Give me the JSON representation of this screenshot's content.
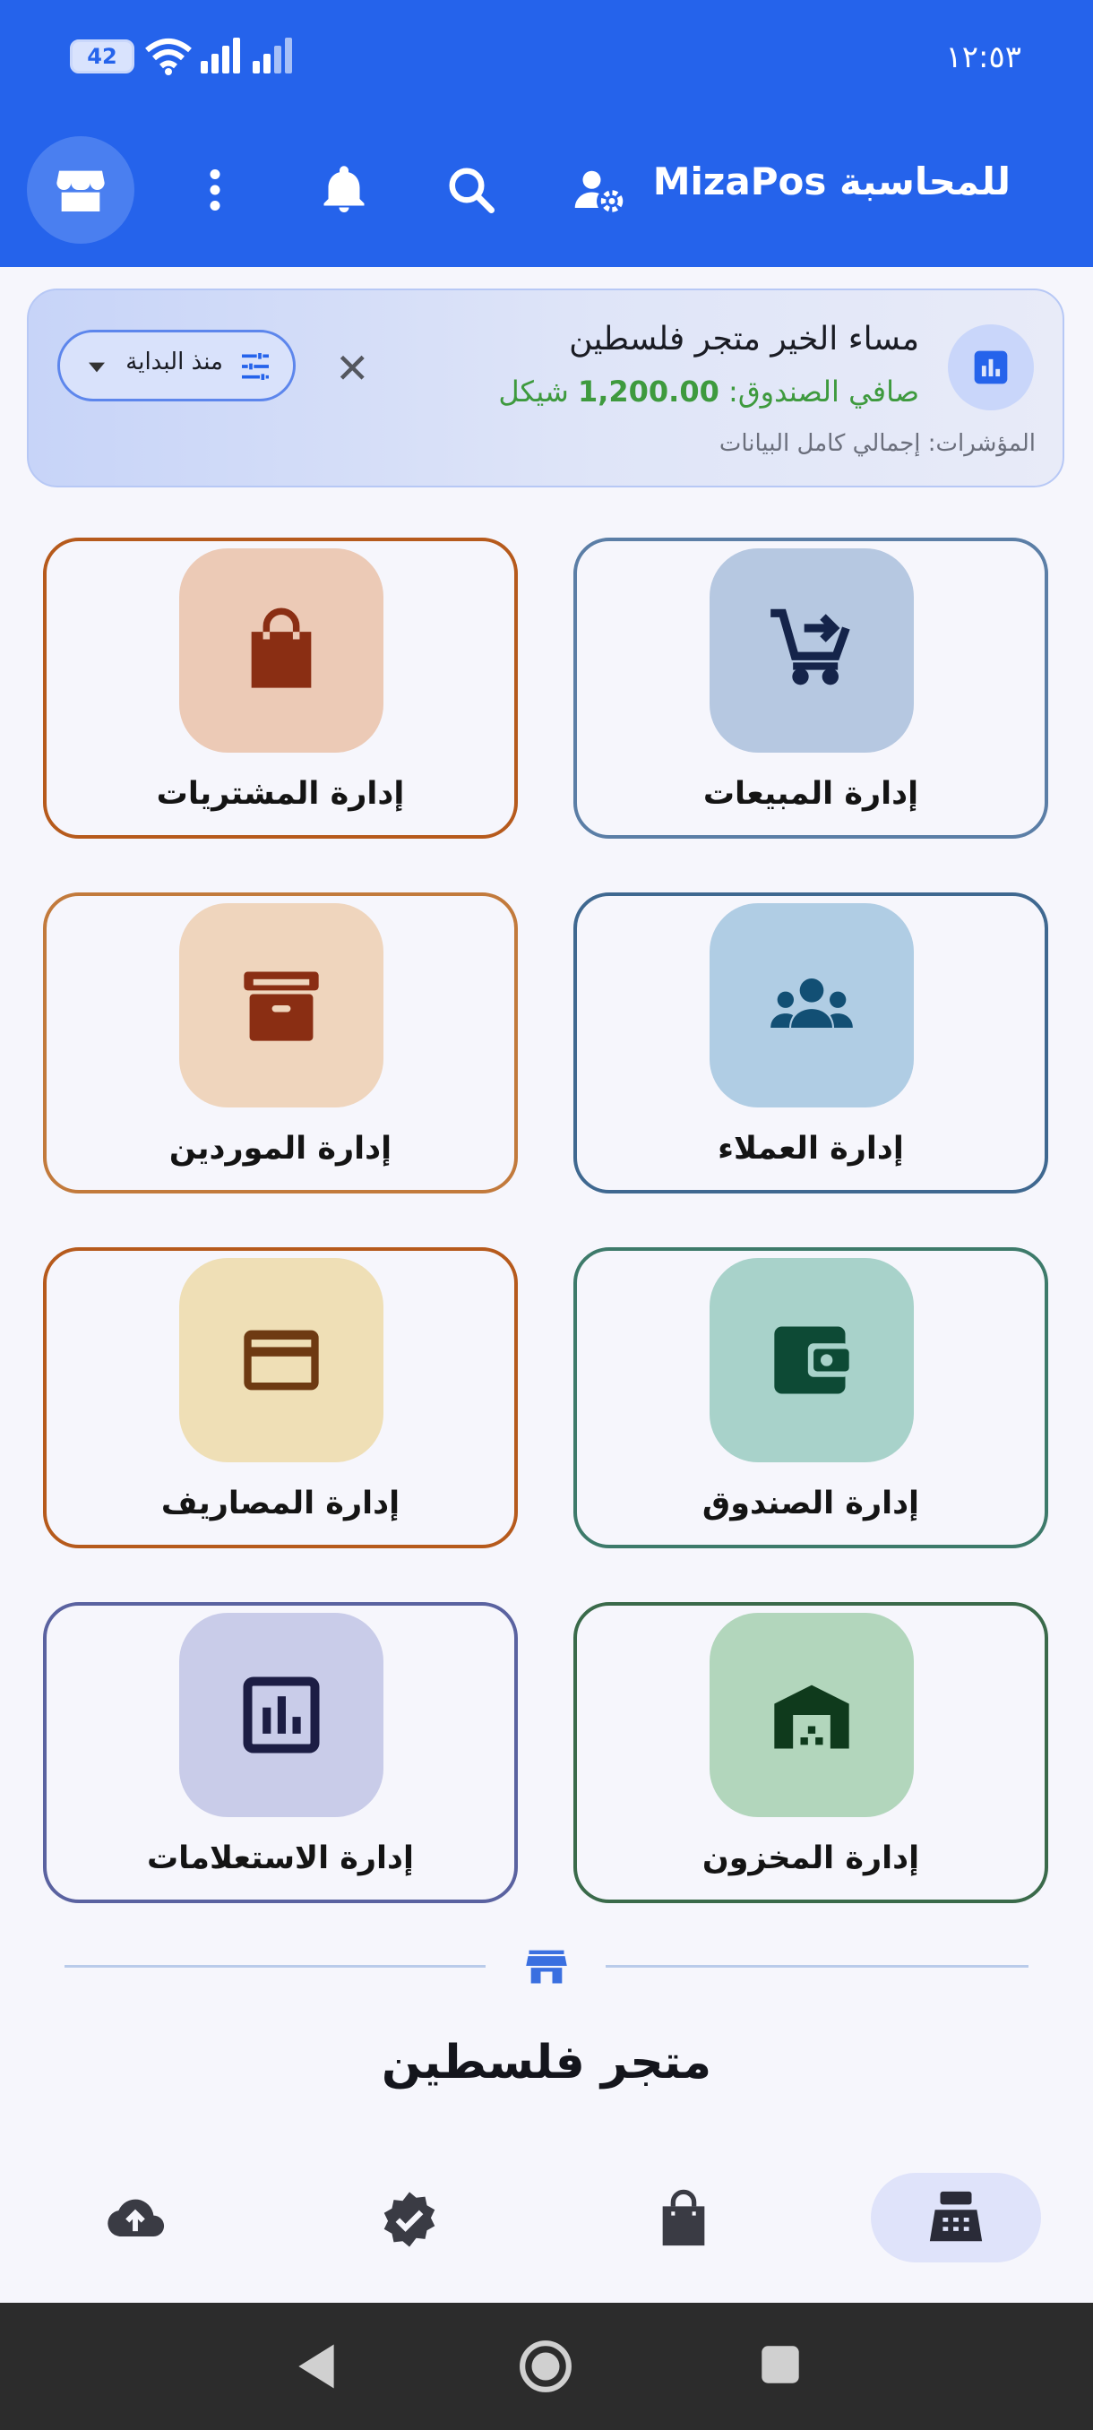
{
  "status_bar": {
    "time": "١٢:٥٣",
    "battery": "42"
  },
  "app_bar": {
    "title": "MizaPos للمحاسبة"
  },
  "banner": {
    "greeting": "مساء الخير متجر فلسطين",
    "cashbox_label": "صافي الصندوق:",
    "cashbox_value": "1,200.00",
    "currency": "شيكل",
    "indicators": "المؤشرات: إجمالي كامل البيانات",
    "filter_label": "منذ البداية"
  },
  "modules": [
    {
      "label": "إدارة المبيعات",
      "icon": "cart-icon"
    },
    {
      "label": "إدارة المشتريات",
      "icon": "shopping-bag-icon"
    },
    {
      "label": "إدارة العملاء",
      "icon": "group-icon"
    },
    {
      "label": "إدارة الموردين",
      "icon": "archive-box-icon"
    },
    {
      "label": "إدارة الصندوق",
      "icon": "wallet-icon"
    },
    {
      "label": "إدارة المصاريف",
      "icon": "credit-card-icon"
    },
    {
      "label": "إدارة المخزون",
      "icon": "warehouse-icon"
    },
    {
      "label": "إدارة الاستعلامات",
      "icon": "bar-chart-icon"
    }
  ],
  "store_name": "متجر فلسطين",
  "colors": {
    "primary": "#2563eb",
    "cash_green": "#3e9a3e"
  }
}
